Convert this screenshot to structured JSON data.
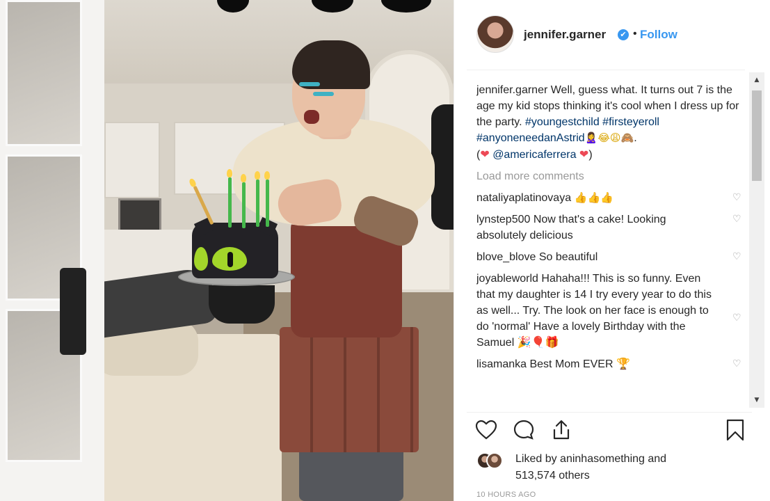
{
  "post": {
    "username": "jennifer.garner",
    "verified_mark": "✔",
    "separator": "•",
    "follow_label": "Follow"
  },
  "caption": {
    "username": "jennifer.garner",
    "text": " Well, guess what. It turns out 7 is the age my kid stops thinking it's cool when I dress up for the party. ",
    "hashtag1": "#youngestchild",
    "hashtag2": "#firsteyeroll",
    "hashtag3": "#anyoneneedanAstrid",
    "emojis": "🙎‍♀️😂😩🙈",
    "period": ".",
    "paren_open": "(",
    "heart": "❤",
    "mention": "@americaferrera",
    "paren_close": ")"
  },
  "load_more_label": "Load more comments",
  "comments": [
    {
      "username": "nataliyaplatinovaya",
      "text": " 👍👍👍"
    },
    {
      "username": "lynstep500",
      "text": " Now that's a cake! Looking absolutely delicious"
    },
    {
      "username": "blove_blove",
      "text": " So beautiful"
    },
    {
      "username": "joyableworld",
      "text": " Hahaha!!! This is so funny. Even that my daughter is 14 I try every year to do this as well... Try. The look on her face is enough to do 'normal' Have a lovely Birthday with the Samuel 🎉🎈🎁"
    },
    {
      "username": "lisamanka",
      "text": " Best Mom EVER 🏆"
    }
  ],
  "icons": {
    "like": "heart-outline-icon",
    "comment": "comment-bubble-icon",
    "share": "share-icon",
    "save": "bookmark-icon",
    "comment_like": "small-heart-icon",
    "scroll_up": "▲",
    "scroll_down": "▼"
  },
  "likes": {
    "prefix": "Liked by ",
    "user": "aninhasomething",
    "suffix": " and",
    "count": "513,574 others"
  },
  "timestamp": "10 HOURS AGO",
  "colors": {
    "link_blue": "#3897f0",
    "hashtag": "#003569",
    "heart_red": "#ed4956",
    "muted": "#999999"
  }
}
